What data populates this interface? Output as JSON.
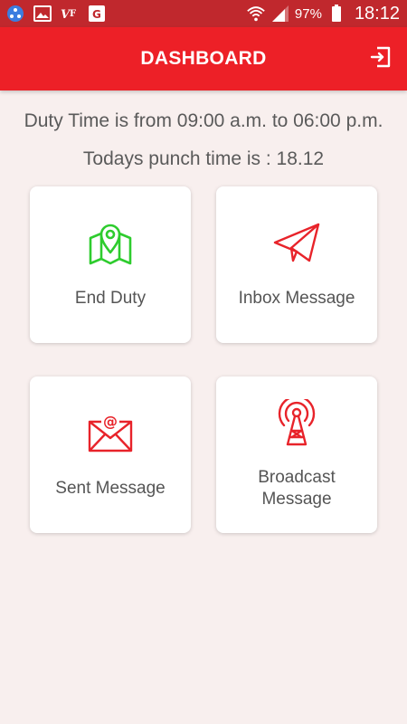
{
  "status_bar": {
    "battery_percent": "97%",
    "time": "18:12"
  },
  "app_bar": {
    "title": "DASHBOARD"
  },
  "info": {
    "duty_time": "Duty Time is from 09:00 a.m. to 06:00 p.m.",
    "punch_time": "Todays punch time is : 18.12"
  },
  "cards": [
    {
      "label": "End Duty",
      "icon": "map-pin-icon",
      "icon_color": "#2ecc2e"
    },
    {
      "label": "Inbox Message",
      "icon": "paper-plane-icon",
      "icon_color": "#e8232a"
    },
    {
      "label": "Sent Message",
      "icon": "email-at-icon",
      "icon_color": "#e8232a"
    },
    {
      "label": "Broadcast\nMessage",
      "icon": "broadcast-tower-icon",
      "icon_color": "#e8232a"
    }
  ],
  "colors": {
    "status_bar": "#c0282d",
    "app_bar": "#ed2027",
    "background": "#f8efee",
    "accent_green": "#2ecc2e",
    "accent_red": "#e8232a"
  }
}
